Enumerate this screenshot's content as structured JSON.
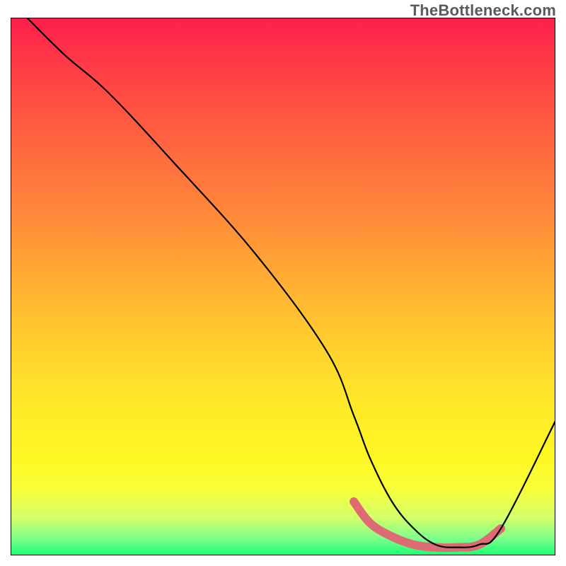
{
  "watermark": "TheBottleneck.com",
  "chart_data": {
    "type": "line",
    "title": "",
    "xlabel": "",
    "ylabel": "",
    "xlim": [
      0,
      100
    ],
    "ylim": [
      0,
      100
    ],
    "grid": false,
    "series": [
      {
        "name": "curve",
        "color": "#000000",
        "x": [
          3,
          10,
          18,
          30,
          45,
          58,
          63,
          66,
          70,
          74,
          78,
          82,
          86,
          90,
          100
        ],
        "y": [
          100,
          93,
          86,
          73,
          56,
          38,
          26,
          18,
          10,
          5,
          2,
          1.5,
          2,
          5,
          25
        ]
      },
      {
        "name": "sweet-spot",
        "color": "#de6b74",
        "x": [
          63,
          66,
          70,
          74,
          78,
          82,
          86,
          90
        ],
        "y": [
          10,
          6,
          3.5,
          2,
          1.5,
          1.5,
          2,
          5
        ]
      }
    ],
    "background_gradient": {
      "top": "#ff1f4b",
      "mid_upper": "#ff8a39",
      "mid": "#ffd22d",
      "mid_lower": "#fff824",
      "bottom": "#1dff74"
    }
  }
}
